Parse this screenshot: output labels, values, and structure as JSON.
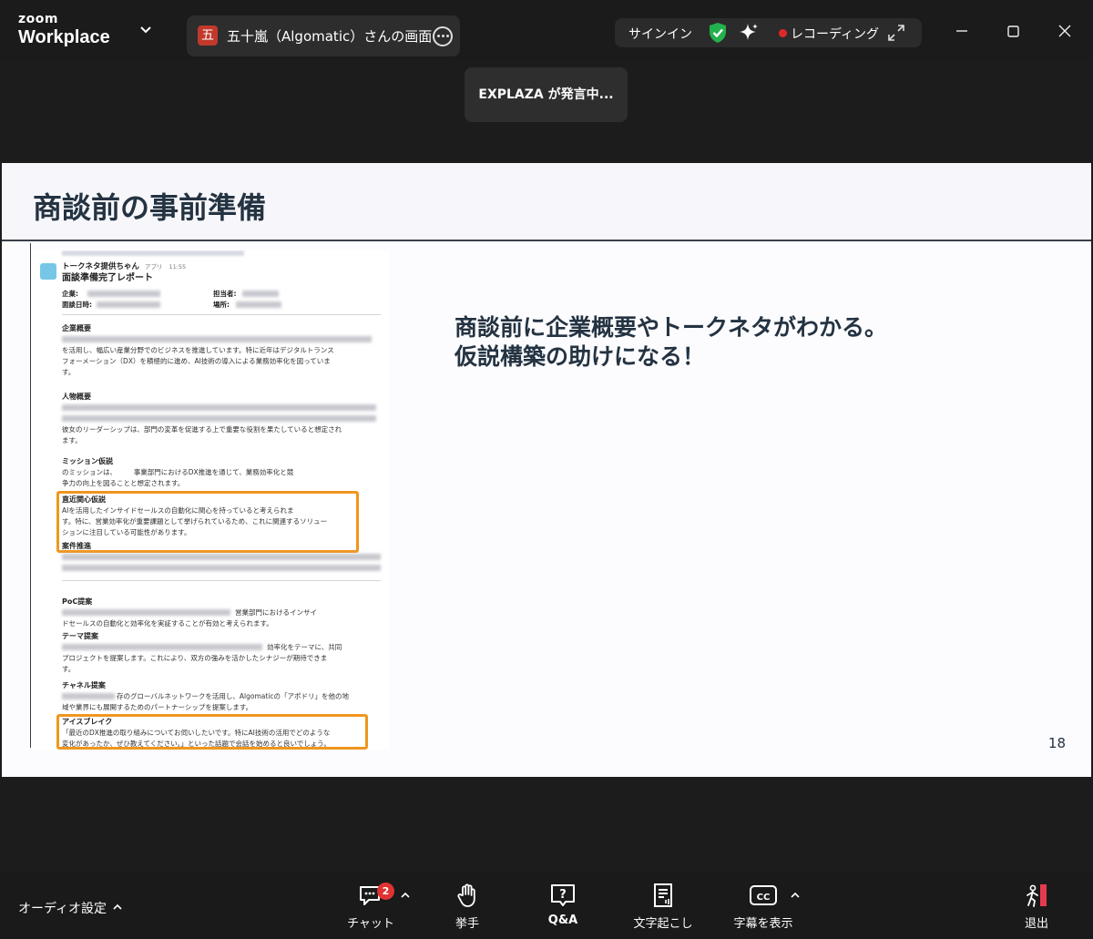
{
  "app": {
    "logo_top": "zoom",
    "logo_bottom": "Workplace",
    "share_tab": {
      "avatar_char": "五",
      "title": "五十嵐（Algomatic）さんの画面"
    },
    "status": {
      "signin": "サインイン",
      "recording": "レコーディング"
    }
  },
  "speaker_toast": "EXPLAZA が発言中...",
  "slide": {
    "title": "商談前の事前準備",
    "message_line1": "商談前に企業概要やトークネタがわかる。",
    "message_line2": "仮説構築の助けになる！",
    "page_number": "18"
  },
  "report": {
    "bot_name": "トークネタ提供ちゃん",
    "bot_tag": "アプリ",
    "bot_time": "11:55",
    "title": "面談準備完了レポート",
    "company_label": "企業:",
    "date_label": "面談日時:",
    "owner_label": "担当者:",
    "place_label": "場所:",
    "sections": [
      {
        "heading": "企業概要",
        "lines": [
          "",
          "を活用し、幅広い産業分野でのビジネスを推進しています。特に近年はデジタルトランス",
          "フォーメーション（DX）を積極的に進め、AI技術の導入による業務効率化を図っていま",
          "す。"
        ]
      },
      {
        "heading": "人物概要",
        "lines": [
          "",
          "",
          "彼女のリーダーシップは、部門の変革を促進する上で重要な役割を果たしていると想定され",
          "ます。"
        ]
      },
      {
        "heading": "ミッション仮説",
        "lines": [
          "のミッションは、　　　事業部門におけるDX推進を通じて、業務効率化と競",
          "争力の向上を図ることと想定されます。"
        ]
      },
      {
        "heading": "直近関心仮説",
        "lines": [
          "AIを活用したインサイドセールスの自動化に関心を持っていると考えられま",
          "す。特に、営業効率化が重要課題として挙げられているため、これに関連するソリュー",
          "ションに注目している可能性があります。"
        ]
      },
      {
        "heading": "案件推進",
        "lines": [
          "",
          ""
        ]
      },
      {
        "heading": "PoC提案",
        "lines": [
          "営業部門におけるインサイ",
          "ドセールスの自動化と効率化を実証することが有効と考えられます。"
        ]
      },
      {
        "heading": "テーマ提案",
        "lines": [
          "効率化をテーマに、共同",
          "プロジェクトを提案します。これにより、双方の強みを活かしたシナジーが期待できま",
          "す。"
        ]
      },
      {
        "heading": "チャネル提案",
        "lines": [
          "存のグローバルネットワークを活用し、Algomaticの「アポドリ」を他の地",
          "域や業界にも展開するためのパートナーシップを提案します。"
        ]
      },
      {
        "heading": "アイスブレイク",
        "lines": [
          "「最近のDX推進の取り組みについてお伺いしたいです。特にAI技術の活用でどのような",
          "変化があったか、ぜひ教えてください。」といった話題で会話を始めると良いでしょう。"
        ]
      }
    ],
    "highlight_color": "#f0961e"
  },
  "toolbar": {
    "audio": "オーディオ設定",
    "chat": "チャット",
    "chat_badge": "2",
    "raise_hand": "挙手",
    "qa": "Q&A",
    "transcript": "文字起こし",
    "captions": "字幕を表示",
    "leave": "退出"
  },
  "colors": {
    "accent_red": "#e02828",
    "shield_green": "#23b14d",
    "title_text": "#243342"
  }
}
